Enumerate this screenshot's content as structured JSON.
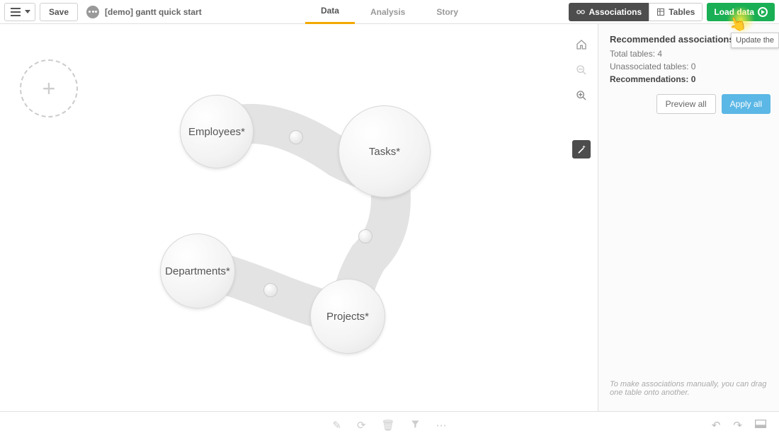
{
  "header": {
    "save_label": "Save",
    "app_title": "[demo] gantt quick start"
  },
  "tabs": {
    "data": "Data",
    "analysis": "Analysis",
    "story": "Story"
  },
  "toolbar": {
    "associations_label": "Associations",
    "tables_label": "Tables",
    "load_data_label": "Load data",
    "tooltip": "Update the"
  },
  "bubbles": {
    "employees": "Employees*",
    "tasks": "Tasks*",
    "departments": "Departments*",
    "projects": "Projects*"
  },
  "panel": {
    "title": "Recommended associations",
    "total_tables_label": "Total tables: ",
    "total_tables_value": "4",
    "unassociated_label": "Unassociated tables: ",
    "unassociated_value": "0",
    "recommendations_label": "Recommendations: ",
    "recommendations_value": "0",
    "preview_label": "Preview all",
    "apply_label": "Apply all",
    "hint": "To make associations manually, you can drag one table onto another."
  }
}
